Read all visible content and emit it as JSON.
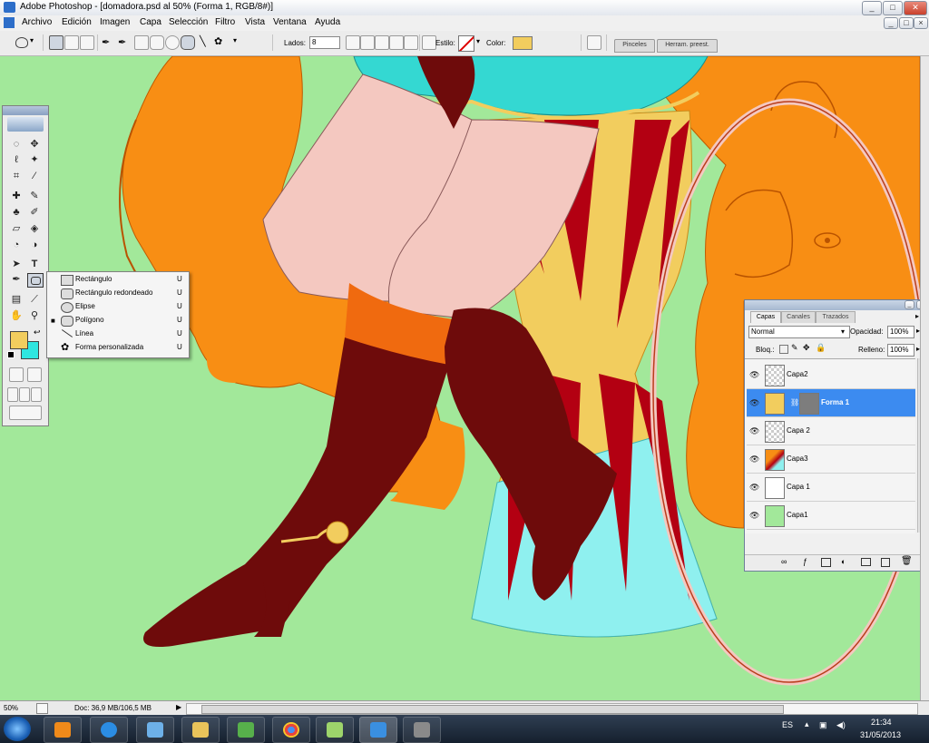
{
  "window": {
    "title": "Adobe Photoshop - [domadora.psd al 50% (Forma 1, RGB/8#)]",
    "controls": [
      "_",
      "□",
      "✕"
    ],
    "doc_controls": [
      "_",
      "□",
      "×"
    ]
  },
  "menu": [
    "Archivo",
    "Edición",
    "Imagen",
    "Capa",
    "Selección",
    "Filtro",
    "Vista",
    "Ventana",
    "Ayuda"
  ],
  "options": {
    "sides_label": "Lados:",
    "sides_value": "8",
    "style_label": "Estilo:",
    "color_label": "Color:",
    "color_value": "#f2cd5e",
    "tab_brushes": "Pinceles",
    "tab_presets": "Herram. preest."
  },
  "flyout": {
    "items": [
      {
        "label": "Rectángulo",
        "key": "U",
        "selected": false,
        "icon": "rectangle-icon"
      },
      {
        "label": "Rectángulo redondeado",
        "key": "U",
        "selected": false,
        "icon": "rounded-rectangle-icon"
      },
      {
        "label": "Elipse",
        "key": "U",
        "selected": false,
        "icon": "ellipse-icon"
      },
      {
        "label": "Polígono",
        "key": "U",
        "selected": true,
        "icon": "polygon-icon"
      },
      {
        "label": "Línea",
        "key": "U",
        "selected": false,
        "icon": "line-icon"
      },
      {
        "label": "Forma personalizada",
        "key": "U",
        "selected": false,
        "icon": "custom-shape-icon"
      }
    ]
  },
  "toolbox": {
    "foreground": "#f2cd5e",
    "background": "#2fe6e0"
  },
  "layers": {
    "tabs": [
      "Capas",
      "Canales",
      "Trazados"
    ],
    "blend_mode": "Normal",
    "opacity_label": "Opacidad:",
    "opacity_value": "100%",
    "lock_label": "Bloq.:",
    "fill_label": "Relleno:",
    "fill_value": "100%",
    "items": [
      {
        "name": "Capa2",
        "selected": false,
        "thumb": "transparent"
      },
      {
        "name": "Forma 1",
        "selected": true,
        "thumb": "shape"
      },
      {
        "name": "Capa 2",
        "selected": false,
        "thumb": "transparent"
      },
      {
        "name": "Capa3",
        "selected": false,
        "thumb": "art"
      },
      {
        "name": "Capa 1",
        "selected": false,
        "thumb": "white"
      },
      {
        "name": "Capa1",
        "selected": false,
        "thumb": "green"
      }
    ]
  },
  "status": {
    "zoom": "50%",
    "doc": "Doc: 36,9 MB/106,5 MB"
  },
  "taskbar": {
    "lang": "ES",
    "time": "21:34",
    "date": "31/05/2013"
  },
  "colors": {
    "canvas_bg": "#a2e89a",
    "selection": "#3c8bf0"
  }
}
